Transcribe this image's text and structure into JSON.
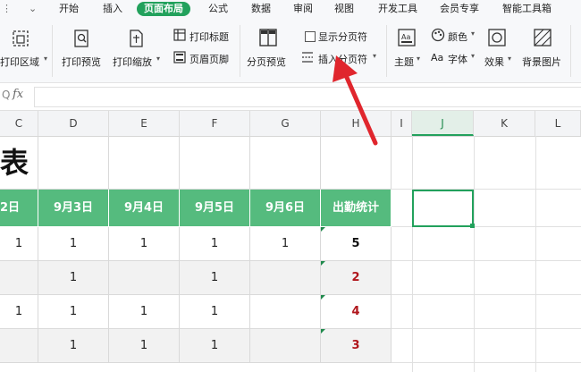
{
  "menubar": {
    "tabs": [
      "开始",
      "插入",
      "页面布局",
      "公式",
      "数据",
      "审阅",
      "视图",
      "开发工具",
      "会员专享",
      "智能工具箱"
    ],
    "active": "页面布局"
  },
  "ribbon": {
    "print_area": "打印区域",
    "print_preview": "打印预览",
    "print_scale": "打印缩放",
    "print_titles": "打印标题",
    "header_footer": "页眉页脚",
    "page_break_preview": "分页预览",
    "show_page_breaks": "显示分页符",
    "insert_page_break": "插入分页符",
    "theme": "主题",
    "colors": "颜色",
    "fonts": "字体",
    "effects": "效果",
    "background_image": "背景图片"
  },
  "formula_bar": {
    "fx": "fx",
    "value": ""
  },
  "columns": [
    "C",
    "D",
    "E",
    "F",
    "G",
    "H",
    "I",
    "J",
    "K",
    "L"
  ],
  "selected_column": "J",
  "sheet": {
    "title_fragment": "表",
    "headers": [
      "2日",
      "9月3日",
      "9月4日",
      "9月5日",
      "9月6日",
      "出勤统计"
    ],
    "rows": [
      [
        "1",
        "1",
        "1",
        "1",
        "1",
        "5"
      ],
      [
        "",
        "1",
        "",
        "1",
        "",
        "2"
      ],
      [
        "1",
        "1",
        "1",
        "1",
        "",
        "4"
      ],
      [
        "",
        "1",
        "1",
        "1",
        "",
        "3"
      ]
    ]
  },
  "colors": {
    "accent": "#22a15c",
    "header_fill": "#55bb7e",
    "count_black": "#111111",
    "count_red": "#b0161c",
    "arrow": "#e0262d"
  }
}
